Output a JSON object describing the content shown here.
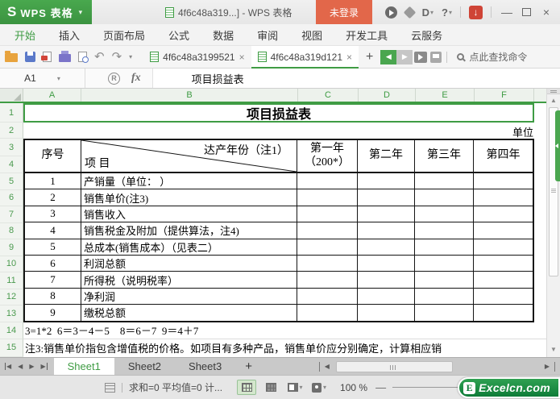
{
  "icons": {
    "caret_down": "▾",
    "undo": "↶",
    "redo": "↷",
    "close": "×",
    "minimize": "—",
    "arrow_left": "◀",
    "arrow_right": "▶",
    "arrow_up": "▲",
    "arrow_down": "▼",
    "plus": "+",
    "download_arrow": "↓",
    "help": "?",
    "docer_d": "D",
    "fx_label": "fx",
    "circle_r": "R",
    "minus": "—"
  },
  "titlebar": {
    "logo_letter": "S",
    "app_name": "WPS 表格",
    "doc_title": "4f6c48a319...] - WPS 表格",
    "login_label": "未登录"
  },
  "menubar": {
    "items": [
      {
        "label": "开始",
        "active": true
      },
      {
        "label": "插入"
      },
      {
        "label": "页面布局"
      },
      {
        "label": "公式"
      },
      {
        "label": "数据"
      },
      {
        "label": "审阅"
      },
      {
        "label": "视图"
      },
      {
        "label": "开发工具"
      },
      {
        "label": "云服务"
      }
    ]
  },
  "doc_tab_bar": {
    "tabs": [
      {
        "label": "4f6c48a3199521",
        "active": false
      },
      {
        "label": "4f6c48a319d121",
        "active": true
      }
    ],
    "find_command": "点此查找命令"
  },
  "formula_bar": {
    "cell_ref": "A1",
    "content": "项目损益表"
  },
  "grid": {
    "columns": [
      "A",
      "B",
      "C",
      "D",
      "E",
      "F"
    ],
    "row_numbers": [
      "1",
      "2",
      "3",
      "4",
      "5",
      "6",
      "7",
      "8",
      "9",
      "10",
      "11",
      "12",
      "13",
      "14",
      "15"
    ],
    "title": "项目损益表",
    "unit_note": "单位",
    "table_header": {
      "serial": "序号",
      "diag_top": "达产年份（注1）",
      "diag_bottom": "项 目",
      "year1_line1": "第一年",
      "year1_line2": "（200*）",
      "year2": "第二年",
      "year3": "第三年",
      "year4": "第四年"
    },
    "items": [
      {
        "no": "1",
        "name": "产销量（单位：  ）"
      },
      {
        "no": "2",
        "name": "销售单价(注3)"
      },
      {
        "no": "3",
        "name": "销售收入"
      },
      {
        "no": "4",
        "name": "销售税金及附加（提供算法，注4)"
      },
      {
        "no": "5",
        "name": "总成本(销售成本）（见表二）"
      },
      {
        "no": "6",
        "name": "利润总额"
      },
      {
        "no": "7",
        "name": "所得税（说明税率）"
      },
      {
        "no": "8",
        "name": "净利润"
      },
      {
        "no": "9",
        "name": "缴税总额"
      }
    ],
    "formula_row": "3=1*2  6＝3－4－5    8＝6－7  9＝4＋7",
    "note_row": "注3:销售单价指包含增值税的价格。如项目有多种产品，销售单价应分别确定，计算相应销"
  },
  "sheet_bar": {
    "tabs": [
      {
        "label": "Sheet1",
        "active": true
      },
      {
        "label": "Sheet2",
        "active": false
      },
      {
        "label": "Sheet3",
        "active": false
      }
    ]
  },
  "status_bar": {
    "summary": "求和=0  平均值=0  计...",
    "zoom_level": "100 %"
  },
  "watermark": {
    "badge": "E",
    "site": "Excelcn.com"
  },
  "colors": {
    "wps_green": "#3f9c44",
    "login_orange": "#e2674a",
    "selection_green": "#3f9c44",
    "watermark_green": "#0e7c38",
    "download_red": "#cf4436",
    "table_border": "#141414"
  }
}
